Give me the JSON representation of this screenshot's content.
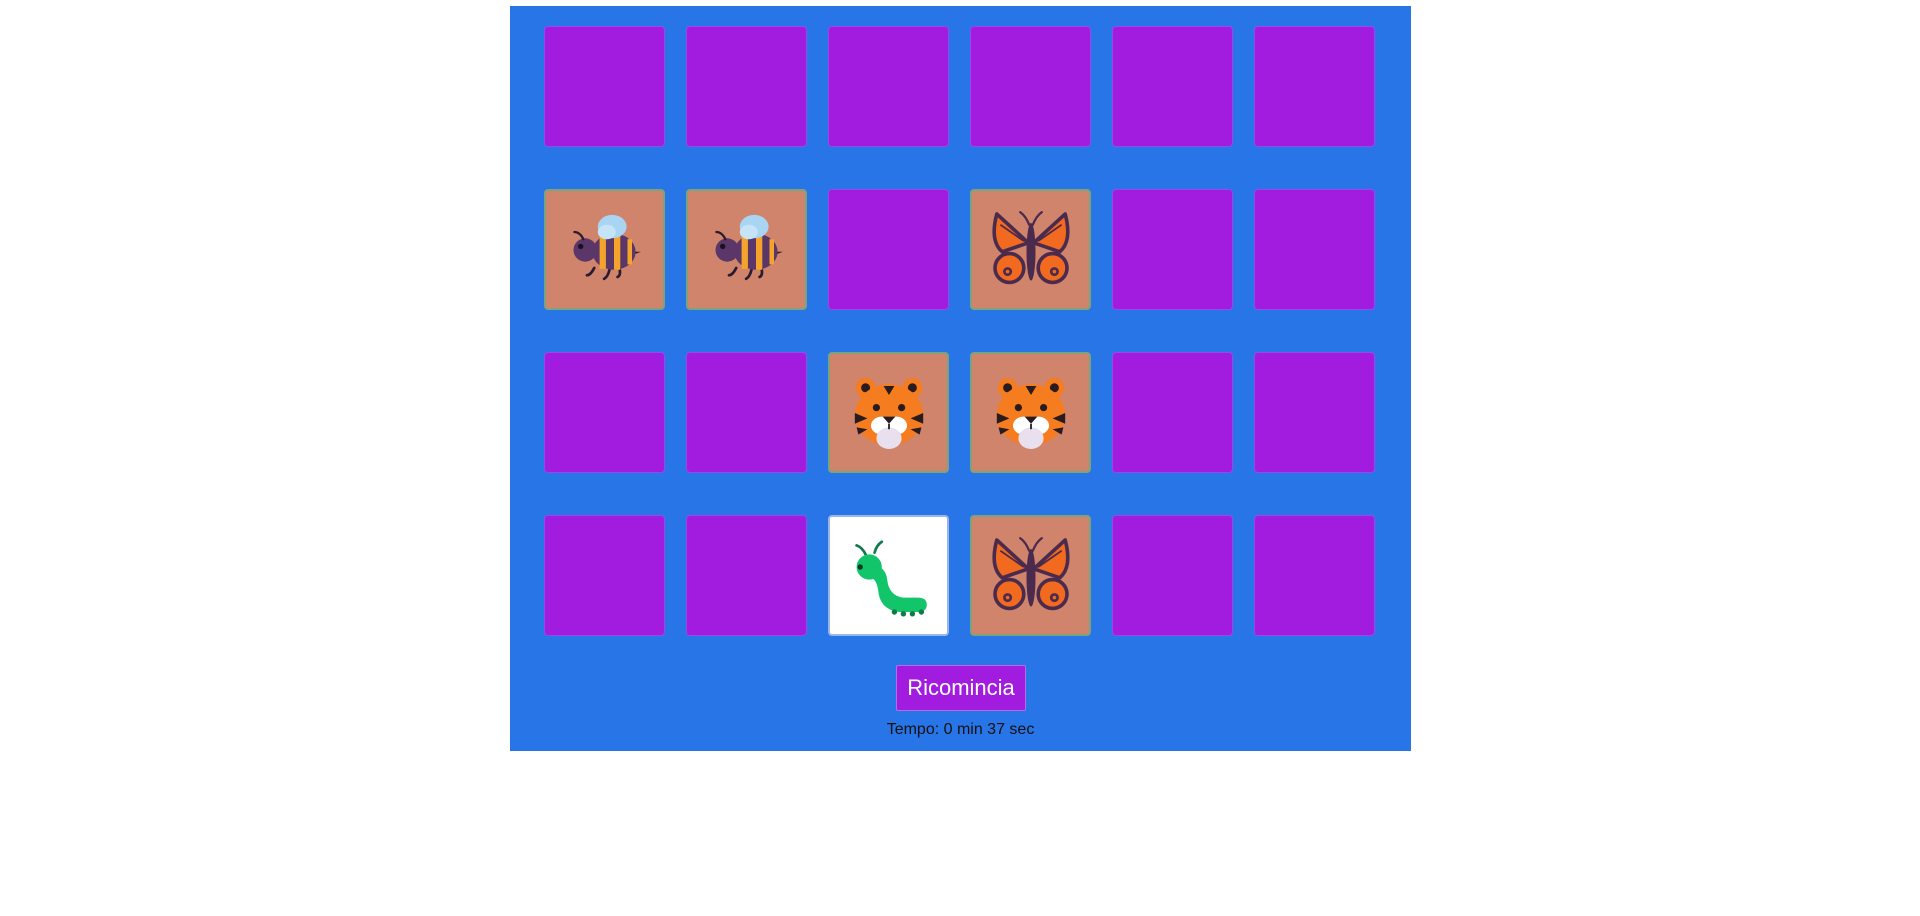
{
  "colors": {
    "board_bg": "#2775e6",
    "card_back": "#a21ce0",
    "card_matched": "#d0846c",
    "card_flipped": "#ffffff"
  },
  "cards": [
    {
      "state": "hidden",
      "icon": null
    },
    {
      "state": "hidden",
      "icon": null
    },
    {
      "state": "hidden",
      "icon": null
    },
    {
      "state": "hidden",
      "icon": null
    },
    {
      "state": "hidden",
      "icon": null
    },
    {
      "state": "hidden",
      "icon": null
    },
    {
      "state": "matched",
      "icon": "bee-icon"
    },
    {
      "state": "matched",
      "icon": "bee-icon"
    },
    {
      "state": "hidden",
      "icon": null
    },
    {
      "state": "matched",
      "icon": "butterfly-icon"
    },
    {
      "state": "hidden",
      "icon": null
    },
    {
      "state": "hidden",
      "icon": null
    },
    {
      "state": "hidden",
      "icon": null
    },
    {
      "state": "hidden",
      "icon": null
    },
    {
      "state": "matched",
      "icon": "tiger-icon"
    },
    {
      "state": "matched",
      "icon": "tiger-icon"
    },
    {
      "state": "hidden",
      "icon": null
    },
    {
      "state": "hidden",
      "icon": null
    },
    {
      "state": "hidden",
      "icon": null
    },
    {
      "state": "hidden",
      "icon": null
    },
    {
      "state": "flipped",
      "icon": "caterpillar-icon"
    },
    {
      "state": "matched",
      "icon": "butterfly-icon"
    },
    {
      "state": "hidden",
      "icon": null
    },
    {
      "state": "hidden",
      "icon": null
    }
  ],
  "controls": {
    "restart_label": "Ricomincia"
  },
  "timer": {
    "text": "Tempo: 0 min 37 sec"
  }
}
